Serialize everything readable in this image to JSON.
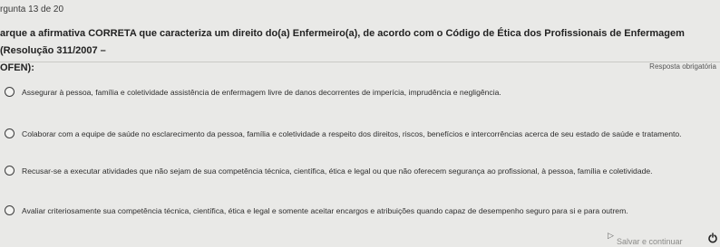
{
  "question_counter": "rgunta 13 de 20",
  "question_text": "arque a afirmativa CORRETA que caracteriza um direito do(a) Enfermeiro(a), de acordo com o Código de Ética dos Profissionais de Enfermagem (Resolução 311/2007 –\nOFEN):",
  "required_label": "Resposta obrigatória",
  "options": [
    {
      "label": "Assegurar à pessoa, família e coletividade assistência de enfermagem livre de danos decorrentes de imperícia, imprudência e negligência."
    },
    {
      "label": "Colaborar com a equipe de saúde no esclarecimento da pessoa, família e coletividade a respeito dos direitos, riscos, benefícios e intercorrências acerca de seu estado de saúde e tratamento."
    },
    {
      "label": "Recusar-se a executar atividades que não sejam de sua competência técnica, científica, ética e legal ou que não oferecem segurança ao profissional, à pessoa, família e coletividade."
    },
    {
      "label": "Avaliar criteriosamente sua competência técnica, científica, ética e legal e somente aceitar encargos e atribuições quando capaz de desempenho seguro para si e para outrem."
    }
  ],
  "save_button_label": "Salvar e continuar",
  "icons": {
    "toggle": "power-icon",
    "cursor": "mouse-cursor-icon",
    "option_marker": "radio-circle-icon"
  }
}
